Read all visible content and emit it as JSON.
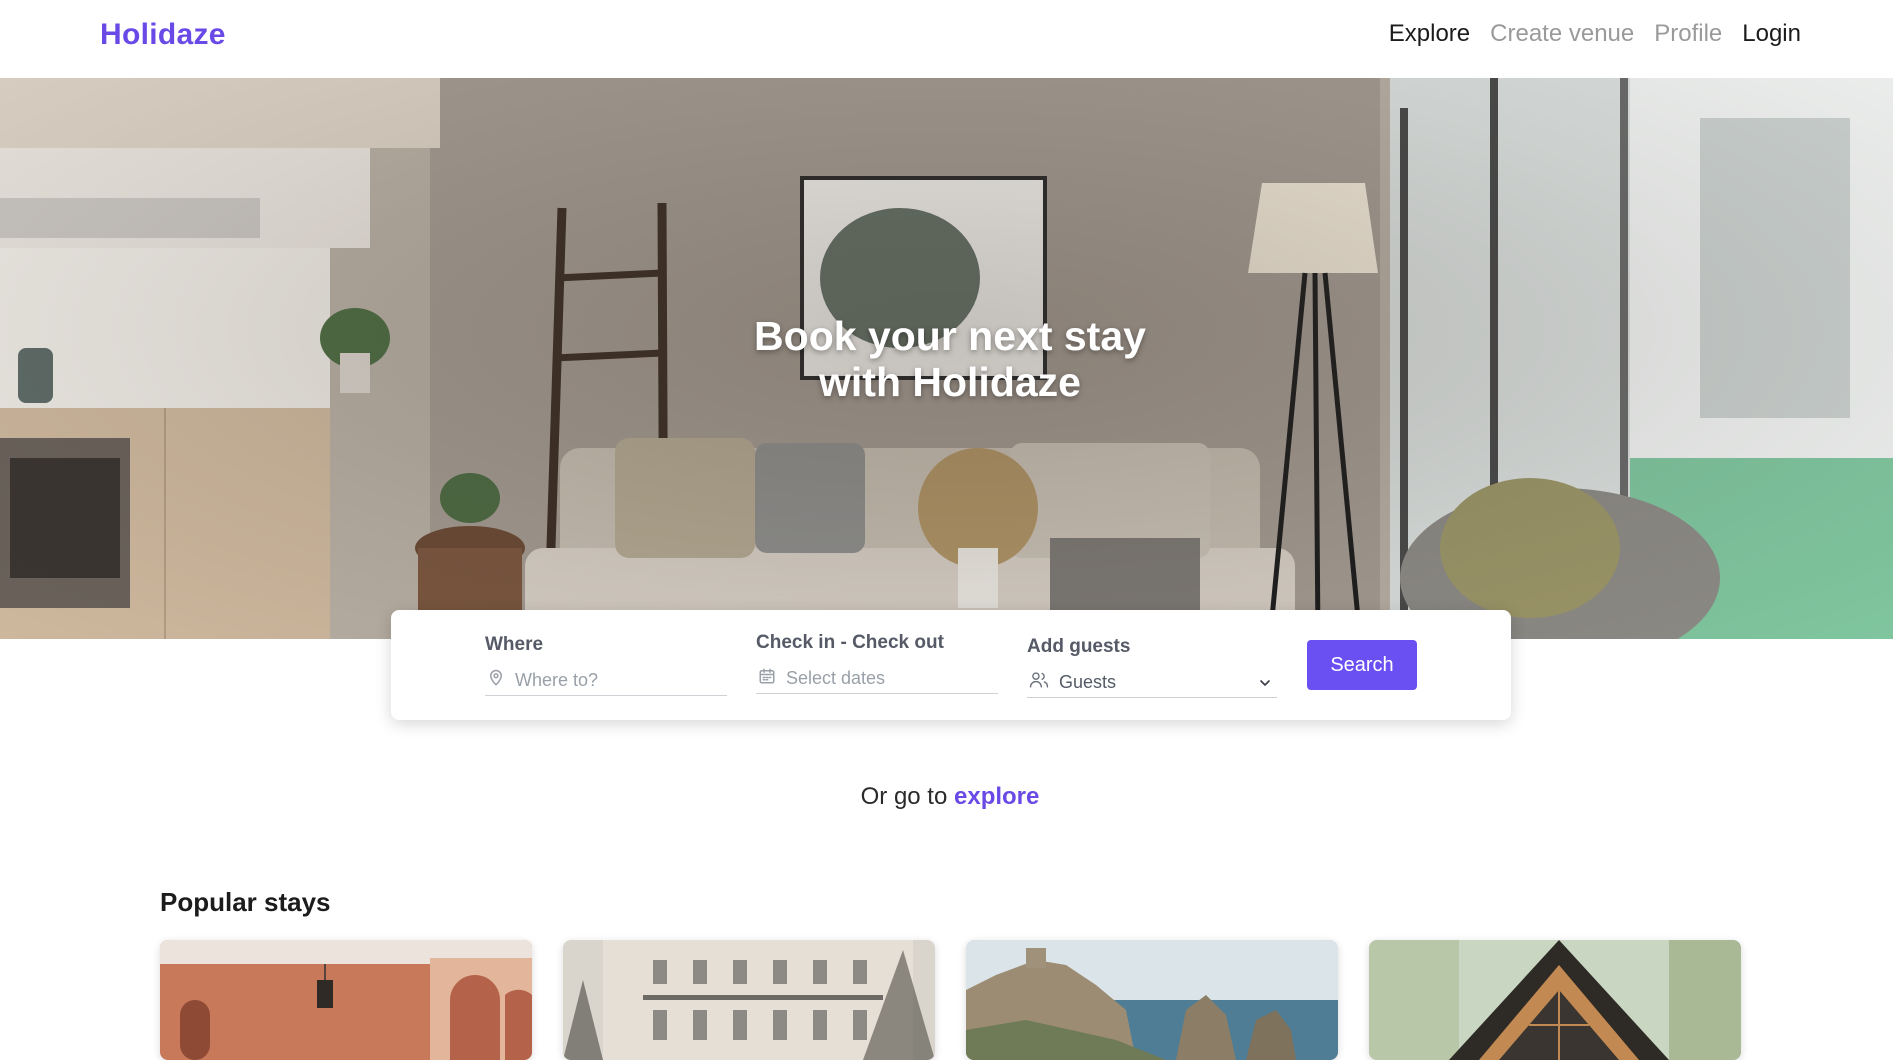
{
  "brand": {
    "name": "Holidaze",
    "color": "#6a4ae6"
  },
  "nav": {
    "items": [
      {
        "label": "Explore",
        "state": "active"
      },
      {
        "label": "Create venue",
        "state": "muted"
      },
      {
        "label": "Profile",
        "state": "muted"
      },
      {
        "label": "Login",
        "state": "default"
      }
    ]
  },
  "hero": {
    "title_line1": "Book your next stay",
    "title_line2": "with Holidaze"
  },
  "search": {
    "where": {
      "label": "Where",
      "placeholder": "Where to?",
      "icon": "map-pin-icon"
    },
    "dates": {
      "label": "Check in - Check out",
      "placeholder": "Select dates",
      "icon": "calendar-icon"
    },
    "guests": {
      "label": "Add guests",
      "value": "Guests",
      "icon": "users-icon",
      "dropdown_icon": "chevron-down-icon"
    },
    "button_label": "Search",
    "button_color": "#6a4ff2"
  },
  "explore": {
    "prefix": "Or go to",
    "link": "explore"
  },
  "popular": {
    "title": "Popular stays",
    "cards": [
      {
        "image": "terracotta arched corridor with lanterns"
      },
      {
        "image": "ornate stone apartment building with trees"
      },
      {
        "image": "coastal rocks and sea with castle ruins"
      },
      {
        "image": "a-frame cabin in a pine forest"
      }
    ]
  }
}
